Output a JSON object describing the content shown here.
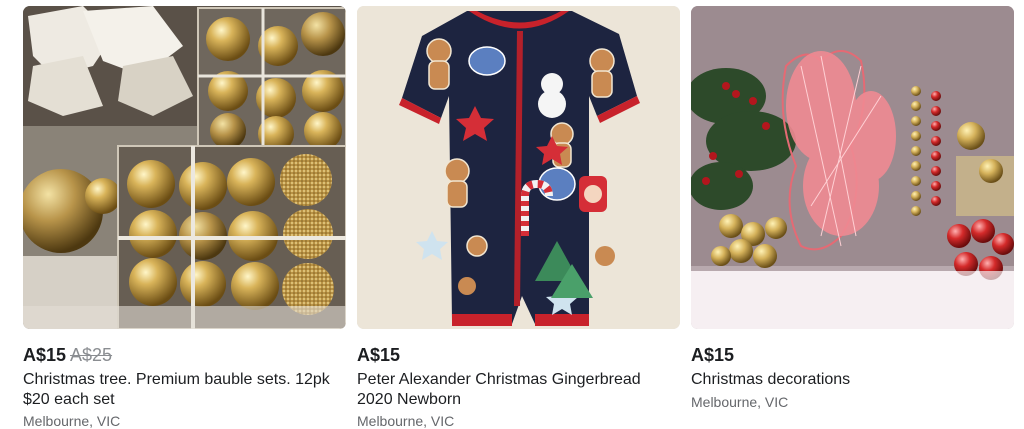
{
  "listings": [
    {
      "price": "A$15",
      "original_price": "A$25",
      "title": "Christmas tree. Premium bauble sets. 12pk $20 each set",
      "location": "Melbourne, VIC",
      "image_subject": "gold-baubles-photo"
    },
    {
      "price": "A$15",
      "title": "Peter Alexander Christmas Gingerbread 2020 Newborn",
      "location": "Melbourne, VIC",
      "image_subject": "gingerbread-romper-photo"
    },
    {
      "price": "A$15",
      "title": "Christmas decorations",
      "location": "Melbourne, VIC",
      "image_subject": "christmas-decorations-photo"
    }
  ],
  "colors": {
    "price_text": "#1c1e21",
    "old_price_text": "#8a8d91",
    "location_text": "#65676b"
  }
}
